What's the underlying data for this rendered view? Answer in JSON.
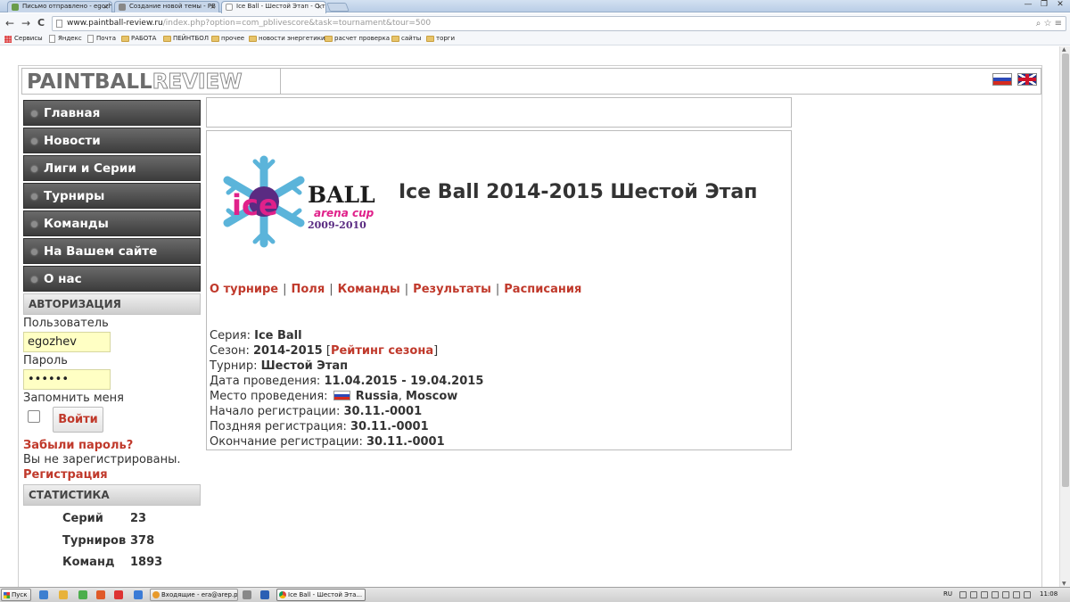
{
  "browser": {
    "tabs": [
      {
        "title": "Письмо отправлено - egozh",
        "active": false
      },
      {
        "title": "Создание новой темы - PB",
        "active": false
      },
      {
        "title": "Ice Ball - Шестой Этап - О т",
        "active": true
      }
    ],
    "tab_close_glyph": "×",
    "window_controls": [
      "—",
      "❐",
      "✕"
    ],
    "url_host": "www.paintball-review.ru",
    "url_path": "/index.php?option=com_pblivescore&task=tournament&tour=500",
    "url_icons": "⌕ ☆ ≡",
    "nav": {
      "back": "←",
      "forward": "→",
      "reload": "C"
    },
    "bookmarks": [
      {
        "label": "Сервисы",
        "kind": "apps"
      },
      {
        "label": "Яндекс",
        "kind": "page"
      },
      {
        "label": "Почта",
        "kind": "page"
      },
      {
        "label": "РАБОТА",
        "kind": "folder"
      },
      {
        "label": "ПЕЙНТБОЛ",
        "kind": "folder"
      },
      {
        "label": "прочее",
        "kind": "folder"
      },
      {
        "label": "новости энергетики",
        "kind": "folder"
      },
      {
        "label": "расчет проверка",
        "kind": "folder"
      },
      {
        "label": "сайты",
        "kind": "folder"
      },
      {
        "label": "торги",
        "kind": "folder"
      }
    ]
  },
  "site": {
    "logo_part1": "PAINTBALL",
    "logo_part2": "REVIEW",
    "menu": [
      "Главная",
      "Новости",
      "Лиги и Серии",
      "Турниры",
      "Команды",
      "На Вашем сайте",
      "О нас"
    ],
    "auth": {
      "heading": "АВТОРИЗАЦИЯ",
      "user_label": "Пользователь",
      "user_value": "egozhev",
      "password_label": "Пароль",
      "password_value": "••••••",
      "remember_label": "Запомнить меня",
      "login_button": "Войти",
      "forgot_link": "Забыли пароль?",
      "not_registered": "Вы не зарегистрированы.",
      "register_link": "Регистрация"
    },
    "stats": {
      "heading": "СТАТИСТИКА",
      "rows": [
        {
          "label": "Серий",
          "value": "23"
        },
        {
          "label": "Турниров",
          "value": "378"
        },
        {
          "label": "Команд",
          "value": "1893"
        }
      ]
    }
  },
  "tournament": {
    "logo": {
      "word1": "ice",
      "word2": "BALL",
      "sub": "arena cup",
      "years": "2009-2010"
    },
    "title": "Ice Ball  2014-2015  Шестой Этап",
    "tabs": [
      "О турнире",
      "Поля",
      "Команды",
      "Результаты",
      "Расписания"
    ],
    "tab_separator": "|",
    "details": {
      "series_label": "Серия: ",
      "series_value": "Ice Ball",
      "season_label": "Сезон: ",
      "season_value": "2014-2015",
      "season_link_open": " [",
      "season_link": "Рейтинг сезона",
      "season_link_close": "]",
      "tour_label": "Турнир: ",
      "tour_value": "Шестой Этап",
      "dates_label": "Дата проведения: ",
      "dates_value": "11.04.2015 - 19.04.2015",
      "place_label": "Место проведения: ",
      "place_country": "Russia",
      "place_sep": ", ",
      "place_city": "Moscow",
      "reg_start_label": "Начало регистрации: ",
      "reg_start_value": "30.11.-0001",
      "reg_late_label": "Поздняя регистрация: ",
      "reg_late_value": "30.11.-0001",
      "reg_end_label": "Окончание регистрации: ",
      "reg_end_value": "30.11.-0001"
    }
  },
  "taskbar": {
    "start": "Пуск",
    "tasks": [
      {
        "label": "Входящие - era@arep.p...",
        "active": false
      },
      {
        "label": "Ice Ball - Шестой Эта...",
        "active": true
      }
    ],
    "lang": "RU",
    "clock": "11:08"
  },
  "colors": {
    "accent": "#c0392b",
    "menu_dark": "#3c3c3c",
    "input_bg": "#ffffc4"
  }
}
